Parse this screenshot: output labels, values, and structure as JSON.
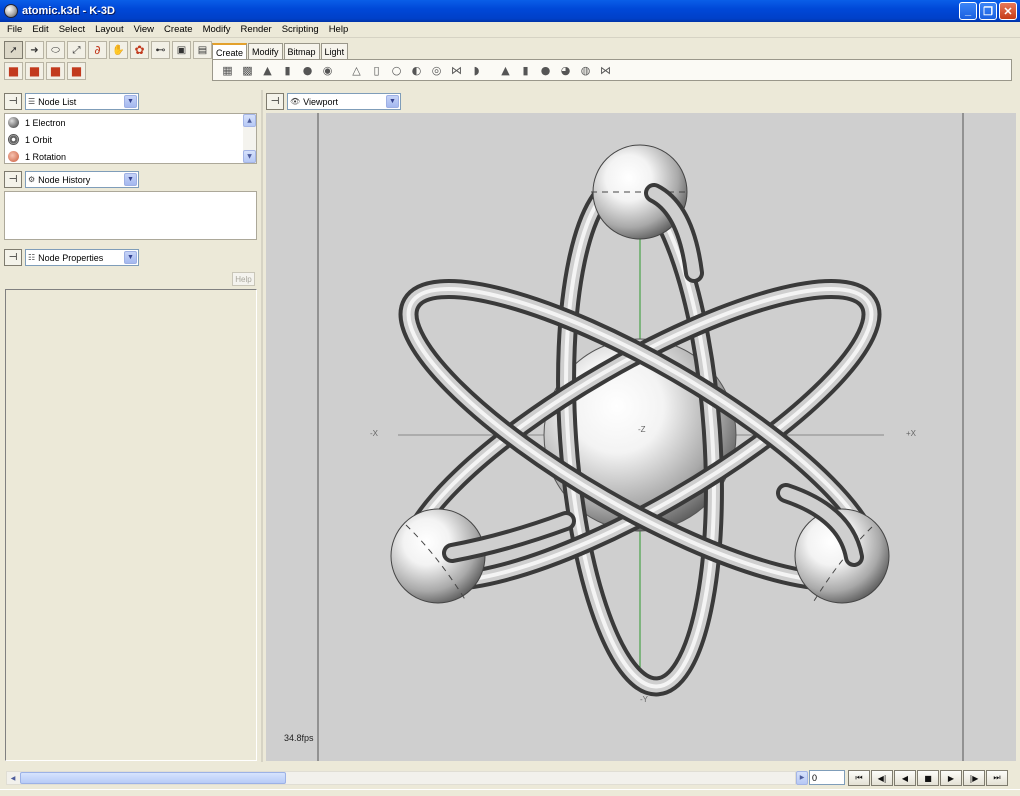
{
  "window": {
    "title": "atomic.k3d - K-3D"
  },
  "menu": [
    "File",
    "Edit",
    "Select",
    "Layout",
    "View",
    "Create",
    "Modify",
    "Render",
    "Scripting",
    "Help"
  ],
  "toolbar": {
    "row1_icons": [
      "select-icon",
      "move-icon",
      "rotate-icon",
      "scale-icon",
      "snap-icon",
      "tweak-icon",
      "paint-icon",
      "plugin-icon",
      "render-frame-icon",
      "render-animation-icon"
    ],
    "row2_icons": [
      "cube-red-icon",
      "cube-red-2-icon",
      "cube-red-3-icon",
      "cube-red-4-icon"
    ],
    "tabs": [
      "Create",
      "Modify",
      "Bitmap",
      "Light"
    ],
    "active_tab": "Create"
  },
  "panels": {
    "node_list": {
      "title": "Node List",
      "items": [
        {
          "label": "1 Electron",
          "icon": "electron-icon"
        },
        {
          "label": "1 Orbit",
          "icon": "orbit-icon"
        },
        {
          "label": "1 Rotation",
          "icon": "rotation-icon"
        }
      ]
    },
    "node_history": {
      "title": "Node History"
    },
    "node_properties": {
      "title": "Node Properties",
      "help_label": "Help"
    }
  },
  "viewport": {
    "title": "Viewport",
    "fps": "34.8fps",
    "axes": {
      "neg_x": "-X",
      "pos_x": "+X",
      "y": "-Y",
      "z": "-Z"
    }
  },
  "timeline": {
    "frame": "0"
  },
  "colors": {
    "titlebar": "#0048d8",
    "accent_tab": "#e3a12d",
    "viewport_bg": "#cfcfcf"
  }
}
